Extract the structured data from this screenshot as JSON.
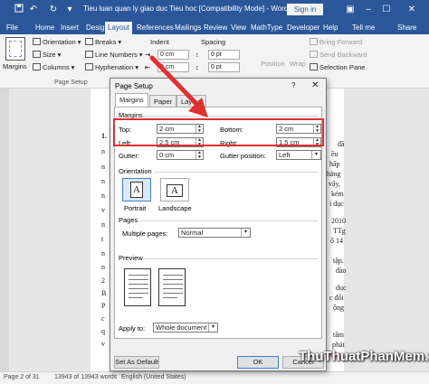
{
  "window": {
    "title": "Tieu luan quan ly giao duc Tieu hoc [Compatibility Mode] - Word",
    "signin": "Sign in",
    "icons": [
      "save-icon",
      "undo-icon",
      "redo-icon",
      "customize-icon"
    ]
  },
  "tabs": [
    "File",
    "Home",
    "Insert",
    "Design",
    "Layout",
    "References",
    "Mailings",
    "Review",
    "View",
    "MathType",
    "Developer",
    "Help",
    "Tell me",
    "Share"
  ],
  "ribbon": {
    "margins": "Margins",
    "orientation": "Orientation",
    "size": "Size",
    "columns": "Columns",
    "breaks": "Breaks",
    "line_numbers": "Line Numbers",
    "hyphenation": "Hyphenation",
    "indent": "Indent",
    "indent_left": "0 cm",
    "indent_right": "0 cm",
    "spacing": "Spacing",
    "spacing_before": "0 pt",
    "spacing_after": "0 pt",
    "position": "Position",
    "wrap": "Wrap",
    "bring_forward": "Bring Forward",
    "send_backward": "Send Backward",
    "selection_pane": "Selection Pane",
    "page_setup_group": "Page Setup"
  },
  "document": {
    "fragments_left": [
      "1.",
      "n",
      "n",
      "n",
      "n",
      "v",
      "n",
      "t",
      "n",
      "n",
      "2",
      "B",
      "P",
      "c",
      "q",
      "v"
    ],
    "fragments_right": [
      "đã",
      "ều",
      "hấp",
      "hẳng",
      "vậy,",
      "kém",
      "i dục",
      "2010",
      "TTg",
      "ố 14",
      "tập.",
      "đào",
      "dục",
      "c đổi",
      "ộng",
      "tâm",
      "phát",
      "trọng"
    ]
  },
  "status": {
    "page": "Page 2 of 31",
    "words": "13943 of 13943 words",
    "language": "English (United States)"
  },
  "dialog": {
    "title": "Page Setup",
    "help": "?",
    "tabs": [
      "Margins",
      "Paper",
      "Layout"
    ],
    "margins_section": "Margins",
    "top_label": "Top:",
    "top_value": "2 cm",
    "bottom_label": "Bottom:",
    "bottom_value": "2 cm",
    "left_label": "Left:",
    "left_value": "2.5 cm",
    "right_label": "Right:",
    "right_value": "1.5 cm",
    "gutter_label": "Gutter:",
    "gutter_value": "0 cm",
    "gutter_position_label": "Gutter position:",
    "gutter_position_value": "Left",
    "orientation_section": "Orientation",
    "portrait": "Portrait",
    "landscape": "Landscape",
    "pages_section": "Pages",
    "multiple_pages_label": "Multiple pages:",
    "multiple_pages_value": "Normal",
    "preview_section": "Preview",
    "apply_to_label": "Apply to:",
    "apply_to_value": "Whole document",
    "set_default": "Set As Default",
    "ok": "OK",
    "cancel": "Cancel"
  },
  "watermark": "ThuThuatPhanMem.vn",
  "colors": {
    "titlebar": "#2b579a",
    "highlight": "#e03030"
  }
}
